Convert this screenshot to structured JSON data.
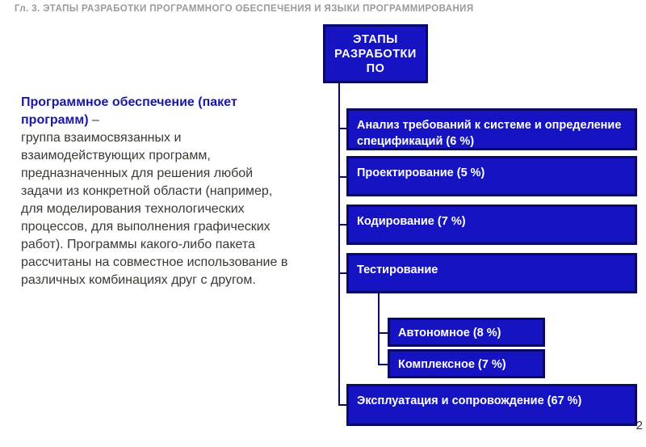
{
  "header": {
    "chapter": "Гл. 3. ЭТАПЫ РАЗРАБОТКИ ПРОГРАММНОГО ОБЕСПЕЧЕНИЯ И ЯЗЫКИ ПРОГРАММИРОВАНИЯ"
  },
  "definition": {
    "term": "Программное обеспечение (пакет программ)",
    "dash": " – ",
    "body": "группа взаимосвязанных и взаимодействующих программ, предназначенных для решения любой задачи из конкретной области (например, для моделирования технологических процессов, для выполнения графических работ). Программы какого-либо пакета рассчитаны на совместное использование в различных комбинациях друг с другом."
  },
  "diagram": {
    "root": "ЭТАПЫ РАЗРАБОТКИ ПО",
    "stages": [
      {
        "label": "Анализ требований к системе и определение спецификаций (6 %)"
      },
      {
        "label": "Проектирование (5 %)"
      },
      {
        "label": "Кодирование (7 %)"
      },
      {
        "label": "Тестирование",
        "children": [
          {
            "label": "Автономное (8 %)"
          },
          {
            "label": "Комплексное (7 %)"
          }
        ]
      },
      {
        "label": "Эксплуатация и сопровождение (67 %)"
      }
    ]
  },
  "page_number": "2"
}
